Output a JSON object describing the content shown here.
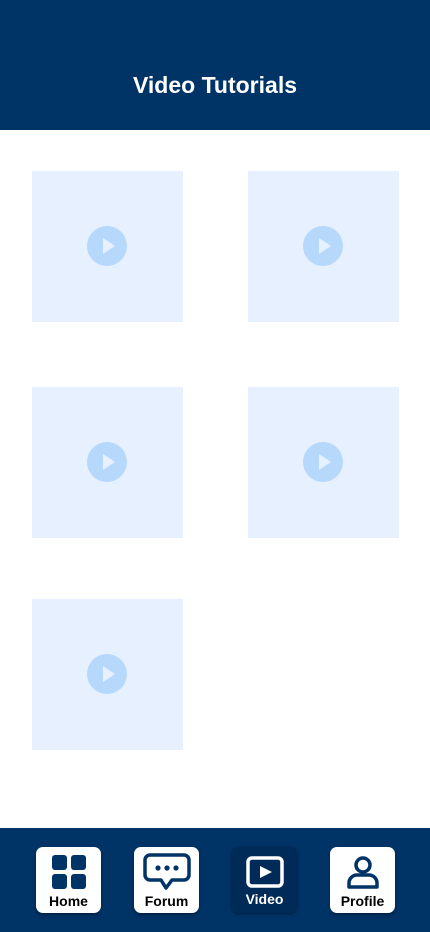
{
  "header": {
    "title": "Video Tutorials"
  },
  "videos": [
    {
      "icon": "play-icon"
    },
    {
      "icon": "play-icon"
    },
    {
      "icon": "play-icon"
    },
    {
      "icon": "play-icon"
    },
    {
      "icon": "play-icon"
    }
  ],
  "bottom_nav": {
    "items": [
      {
        "label": "Home",
        "icon": "grid-icon",
        "active": false
      },
      {
        "label": "Forum",
        "icon": "chat-bubble-icon",
        "active": false
      },
      {
        "label": "Video",
        "icon": "video-play-icon",
        "active": true
      },
      {
        "label": "Profile",
        "icon": "user-icon",
        "active": false
      }
    ]
  },
  "colors": {
    "header_bg": "#003366",
    "nav_bg": "#003366",
    "thumbnail_bg": "#e6f0fe",
    "play_circle": "#b6d8fb",
    "active_nav_bg": "#002b58"
  }
}
